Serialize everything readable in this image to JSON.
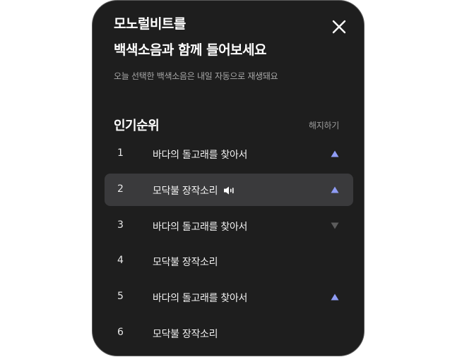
{
  "header": {
    "title_line1": "모노럴비트를",
    "title_line2": "백색소음과 함께 들어보세요",
    "subtitle": "오늘 선택한 백색소음은 내일 자동으로 재생돼요",
    "close_icon": "close-icon"
  },
  "ranking": {
    "section_title": "인기순위",
    "unsubscribe_label": "해지하기",
    "items": [
      {
        "rank": "1",
        "name": "바다의 돌고래를 찾아서",
        "trend": "up",
        "playing": false,
        "selected": false
      },
      {
        "rank": "2",
        "name": "모닥불 장작소리",
        "trend": "up",
        "playing": true,
        "selected": true
      },
      {
        "rank": "3",
        "name": "바다의 돌고래를 찾아서",
        "trend": "down",
        "playing": false,
        "selected": false
      },
      {
        "rank": "4",
        "name": "모닥불 장작소리",
        "trend": "none",
        "playing": false,
        "selected": false
      },
      {
        "rank": "5",
        "name": "바다의 돌고래를 찾아서",
        "trend": "up",
        "playing": false,
        "selected": false
      },
      {
        "rank": "6",
        "name": "모닥불 장작소리",
        "trend": "none",
        "playing": false,
        "selected": false
      }
    ]
  },
  "colors": {
    "background": "#1e1e1e",
    "selected_row": "#3a3a3c",
    "trend_up": "#8f9cf5",
    "trend_down": "#5c5c5c"
  }
}
